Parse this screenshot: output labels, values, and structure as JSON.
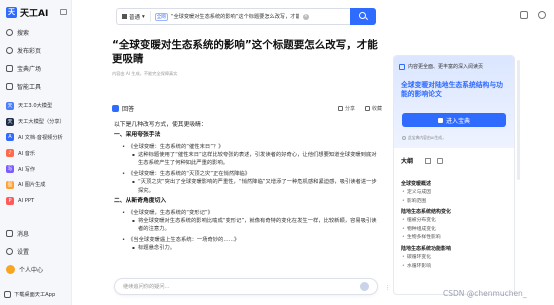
{
  "app": {
    "brand": "天工AI"
  },
  "sidebar": {
    "nav": [
      {
        "label": "搜索",
        "icon": "search-icon"
      },
      {
        "label": "发布彩页",
        "icon": "publish-icon"
      },
      {
        "label": "宝典广场",
        "icon": "square-icon"
      },
      {
        "label": "智能工具",
        "icon": "tools-icon"
      }
    ],
    "tools": [
      {
        "label": "天工3.0大模型",
        "icon_color": "#4a7cff",
        "icon_text": "天"
      },
      {
        "label": "天工大模型（分享）",
        "icon_color": "#1f2d4d",
        "icon_text": "天"
      },
      {
        "label": "AI 文档·音视频分析",
        "icon_color": "#2f6bff",
        "icon_text": "A"
      },
      {
        "label": "AI 音乐",
        "icon_color": "#ff6a4d",
        "icon_text": "♪"
      },
      {
        "label": "AI 写作",
        "icon_color": "#7b5cff",
        "icon_text": "写"
      },
      {
        "label": "AI 图片生成",
        "icon_color": "#ff9f2f",
        "icon_text": "图"
      },
      {
        "label": "AI PPT",
        "icon_color": "#ff5a5a",
        "icon_text": "P"
      }
    ],
    "bottom": [
      {
        "label": "消息",
        "icon": "message-icon"
      },
      {
        "label": "设置",
        "icon": "settings-icon"
      },
      {
        "label": "个人中心",
        "icon": "avatar"
      }
    ],
    "download_label": "下载桌面天工App"
  },
  "search": {
    "mode": "普通",
    "scope": "全网",
    "query": "“全球变暖对生态系统的影响”这个标题要怎么改写，才能更吸睛"
  },
  "article": {
    "title": "“全球变暖对生态系统的影响”这个标题要怎么改写，才能更吸睛",
    "meta": "内容由 AI 生成，不能完全保障真实",
    "answer_label": "回答",
    "share_label": "分享",
    "collect_label": "收藏"
  },
  "answer": {
    "intro": "以下是几种改写方式，使其更吸睛：",
    "sections": [
      {
        "heading": "一、采用夸张手法",
        "bullets": [
          {
            "text": "《全球变暖：生态系统的“催性末日”？》",
            "subs": [
              "这种标题使用了“催性末日”这样比较夸张的表述，引发读者的好奇心，让他们想要知道全球变暖到底对生态系统产生了何种如此严重的影响。"
            ]
          },
          {
            "text": "《全球变暖：生态系统的“灭顶之灾”正在悄然降临》",
            "subs": [
              "“灭顶之灾”突出了全球变暖影响的严重性，“悄然降临”又增添了一种危机感和紧迫感，吸引读者进一步探究。"
            ]
          }
        ]
      },
      {
        "heading": "二、从新奇角度切入",
        "bullets": [
          {
            "text": "《全球变暖，生态系统的“变形记”》",
            "subs": [
              "将全球变暖对生态系统的影响比喻成“变形记”，就像有奇特的变化在发生一样，比较新颖，容易吸引读者的注意力。"
            ]
          },
          {
            "text": "《当全球变暖遇上生态系统：一场奇妙的……》",
            "subs": [
              "标题悬念引力。"
            ]
          }
        ]
      }
    ]
  },
  "chat": {
    "placeholder": "继续追问你的疑问..."
  },
  "panel": {
    "promo_head": "内容更全面、更丰富的深入阅读页",
    "promo_title": "全球变暖对陆地生态系统结构与功能的影响论文",
    "promo_button": "进入宝典",
    "promo_note": "此宝典内容由AI生成，"
  },
  "outline": {
    "title": "大纲",
    "groups": [
      {
        "heading": "全球变暖概述",
        "items": [
          "定义与成因",
          "影响范围"
        ]
      },
      {
        "heading": "陆地生态系统结构变化",
        "items": [
          "植被分布变化",
          "物种组成变化",
          "生物多样性影响"
        ]
      },
      {
        "heading": "陆地生态系统功能影响",
        "items": [
          "碳循环变化",
          "水循环影响"
        ]
      }
    ]
  },
  "watermark": "CSDN @chenmuchen_"
}
